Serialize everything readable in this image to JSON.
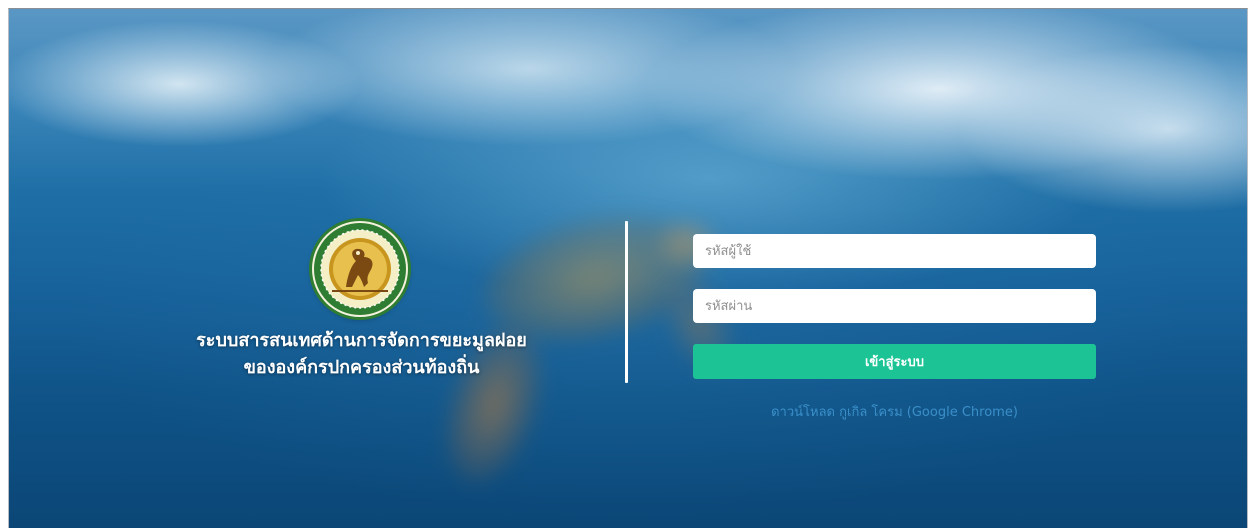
{
  "background": {
    "description_icon": "sea-turtle-underwater-background"
  },
  "branding": {
    "logo_icon": "department-of-local-administration-seal-icon",
    "title_line1": "ระบบสารสนเทศด้านการจัดการขยะมูลฝอย",
    "title_line2": "ขององค์กรปกครองส่วนท้องถิ่น"
  },
  "login": {
    "username_placeholder": "รหัสผู้ใช้",
    "username_value": "",
    "password_placeholder": "รหัสผ่าน",
    "password_value": "",
    "submit_label": "เข้าสู่ระบบ",
    "download_link": "ดาวน์โหลด กูเกิล โครม (Google Chrome)"
  },
  "colors": {
    "button": "#1cc395",
    "link": "#3b8fc9",
    "divider": "#ffffff",
    "seal_ring": "#2e7d32",
    "seal_inner": "#c8961e"
  }
}
